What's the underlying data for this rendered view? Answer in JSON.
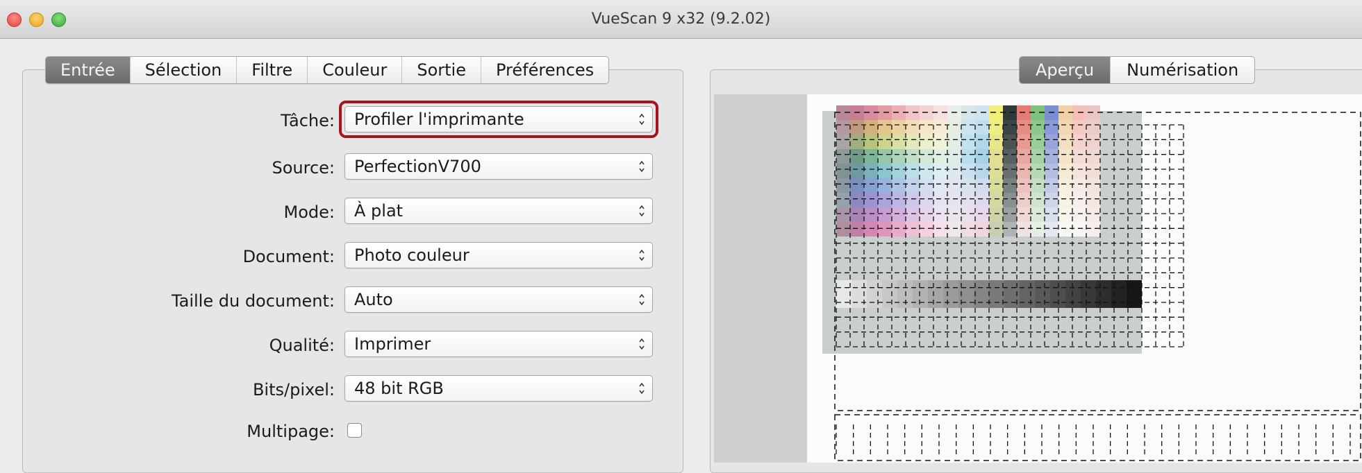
{
  "window": {
    "title": "VueScan 9 x32 (9.2.02)"
  },
  "left_tabs": [
    "Entrée",
    "Sélection",
    "Filtre",
    "Couleur",
    "Sortie",
    "Préférences"
  ],
  "left_active_tab": "Entrée",
  "form": {
    "tache": {
      "label": "Tâche:",
      "value": "Profiler l'imprimante"
    },
    "source": {
      "label": "Source:",
      "value": "PerfectionV700"
    },
    "mode": {
      "label": "Mode:",
      "value": "À plat"
    },
    "document": {
      "label": "Document:",
      "value": "Photo couleur"
    },
    "taille": {
      "label": "Taille du document:",
      "value": "Auto"
    },
    "qualite": {
      "label": "Qualité:",
      "value": "Imprimer"
    },
    "bits": {
      "label": "Bits/pixel:",
      "value": "48 bit RGB"
    },
    "multipage": {
      "label": "Multipage:",
      "checked": false
    }
  },
  "right_tabs": [
    "Aperçu",
    "Numérisation"
  ],
  "right_active_tab": "Aperçu",
  "colors": {
    "highlight": "#a8141e",
    "active_tab": "#7a7a7a"
  }
}
